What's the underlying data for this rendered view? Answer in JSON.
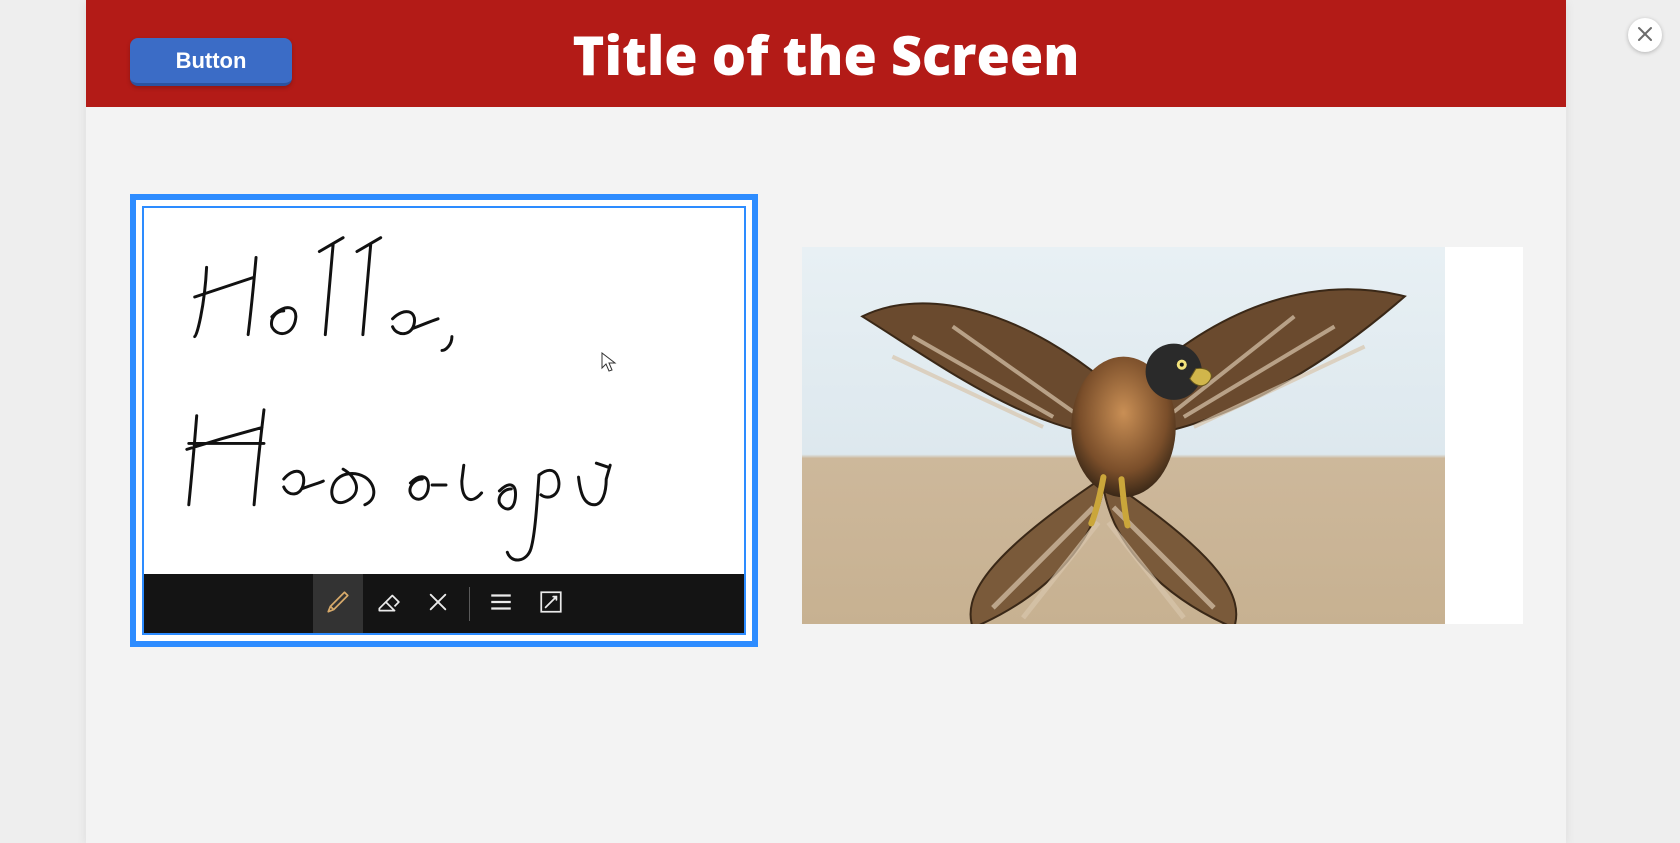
{
  "header": {
    "button_label": "Button",
    "title": "Title of the Screen"
  },
  "close": {
    "icon": "close-icon"
  },
  "ink": {
    "text_line1": "Hello,",
    "text_line2": "How are you",
    "tools": {
      "pen": "pen-icon",
      "eraser": "eraser-icon",
      "clear": "clear-icon",
      "lines": "lines-icon",
      "edit": "edit-icon"
    }
  },
  "image": {
    "description": "falcon-in-flight"
  }
}
